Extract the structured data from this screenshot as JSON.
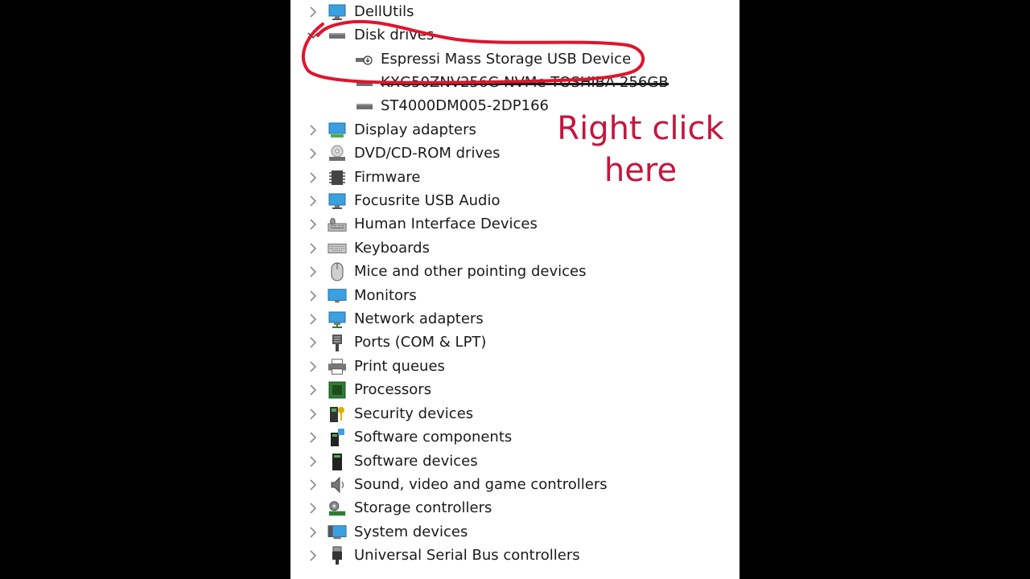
{
  "tree": {
    "top_item": "DellUtils",
    "expanded_category": "Disk drives",
    "disk_children": [
      "Espressi Mass Storage USB Device",
      "KXG50ZNV256G NVMe TOSHIBA 256GB",
      "ST4000DM005-2DP166"
    ],
    "categories": [
      "Display adapters",
      "DVD/CD-ROM drives",
      "Firmware",
      "Focusrite USB Audio",
      "Human Interface Devices",
      "Keyboards",
      "Mice and other pointing devices",
      "Monitors",
      "Network adapters",
      "Ports (COM & LPT)",
      "Print queues",
      "Processors",
      "Security devices",
      "Software components",
      "Software devices",
      "Sound, video and game controllers",
      "Storage controllers",
      "System devices",
      "Universal Serial Bus controllers"
    ]
  },
  "annotation": {
    "line1": "Right click",
    "line2": "here",
    "color": "#c4163c"
  },
  "icons": {
    "top_item": "monitor-icon",
    "disk": "drive-icon",
    "usb_device": "usb-drive-icon",
    "categories": [
      "display-adapter-icon",
      "dvd-icon",
      "firmware-icon",
      "audio-device-icon",
      "hid-icon",
      "keyboard-icon",
      "mouse-icon",
      "monitor-icon",
      "network-icon",
      "port-icon",
      "printer-icon",
      "processor-icon",
      "security-icon",
      "software-components-icon",
      "software-devices-icon",
      "sound-icon",
      "storage-controller-icon",
      "system-devices-icon",
      "usb-icon"
    ]
  }
}
